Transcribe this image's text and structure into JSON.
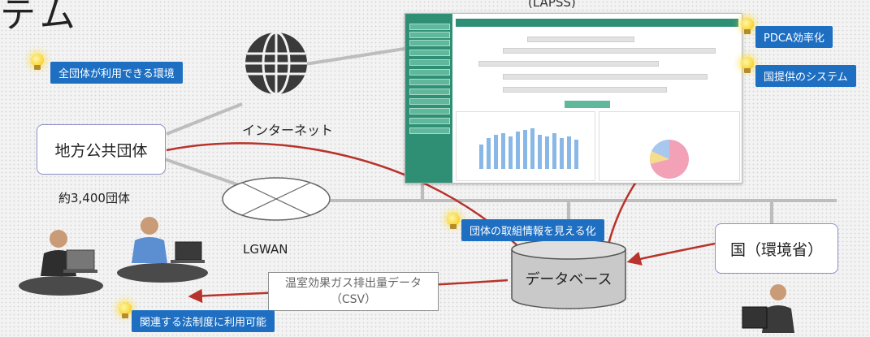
{
  "heading": "テム",
  "system_abbrev": "(LAPSS)",
  "callouts": {
    "all_orgs": "全団体が利用できる環境",
    "pdca": "PDCA効率化",
    "national": "国提供のシステム",
    "visualize": "団体の取組情報を見える化",
    "legal": "関連する法制度に利用可能"
  },
  "nodes": {
    "internet": "インターネット",
    "local_gov": "地方公共団体",
    "local_count": "約3,400団体",
    "lgwan": "LGWAN",
    "database": "データベース",
    "ministry": "国（環境省）"
  },
  "csv_label": {
    "line1": "温室効果ガス排出量データ",
    "line2": "（CSV）"
  },
  "colors": {
    "callout": "#1e6fc2",
    "arrow": "#b8332b",
    "box_border": "#8a8fc9",
    "screen_accent": "#2f8f75"
  }
}
